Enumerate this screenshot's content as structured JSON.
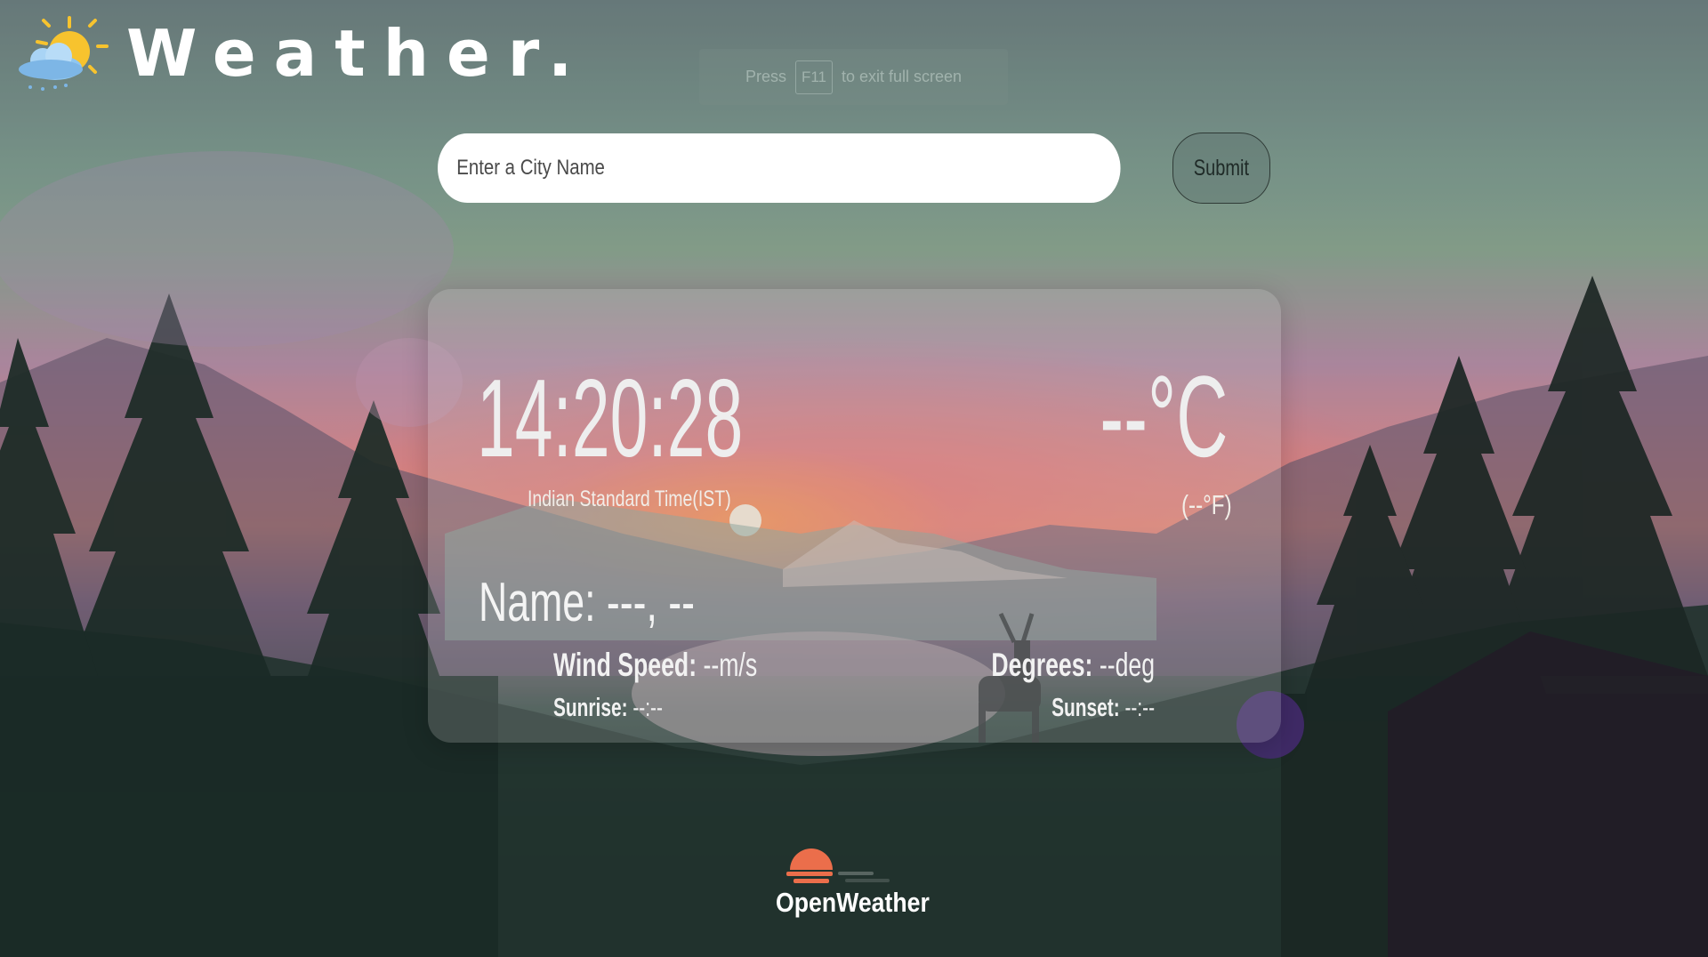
{
  "header": {
    "title": "Weather.",
    "logo_icon": "sun-behind-rain-cloud-icon"
  },
  "fullscreen_hint": {
    "before": "Press",
    "key": "F11",
    "after": "to exit full screen"
  },
  "search": {
    "placeholder": "Enter a City Name",
    "value": "",
    "submit_label": "Submit"
  },
  "card": {
    "time": "14:20:28",
    "timezone": "Indian Standard Time(IST)",
    "temp_c": "--°C",
    "temp_f": "(--°F)",
    "name_line": "Name: ---, --",
    "wind_label": "Wind Speed:",
    "wind_value": " --m/s",
    "sunrise_label": "Sunrise:",
    "sunrise_value": " --:--",
    "degrees_label": "Degrees:",
    "degrees_value": " --deg",
    "sunset_label": "Sunset:",
    "sunset_value": " --:--"
  },
  "footer": {
    "brand": "OpenWeather",
    "brand_icon": "openweather-sun-icon"
  },
  "colors": {
    "card_bg": "rgba(200,200,200,0.22)",
    "brand_orange": "#eb6e4b",
    "sun_yellow": "#f7c32e"
  }
}
